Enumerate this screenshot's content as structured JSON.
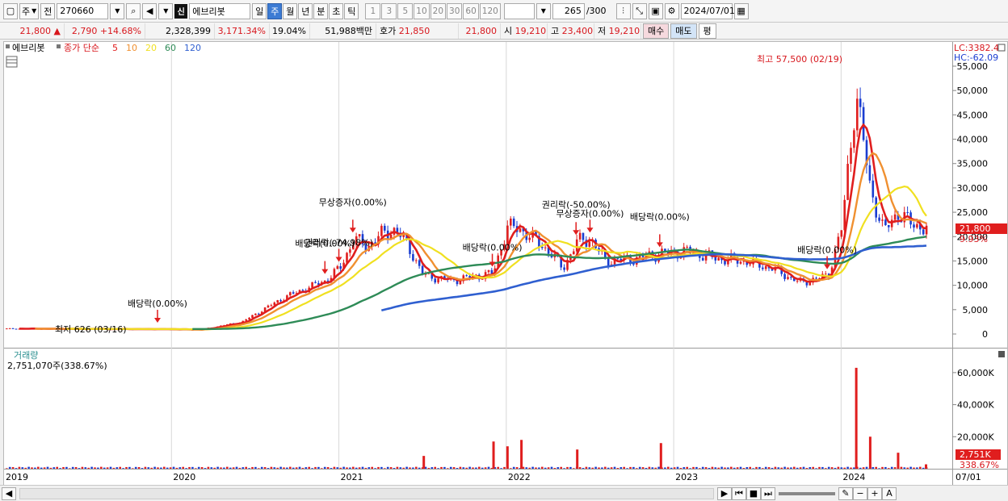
{
  "toolbar": {
    "period_type": "주",
    "prev_label": "전",
    "code": "270660",
    "market_badge": "신",
    "stock_name": "에브리봇",
    "periods": [
      "일",
      "주",
      "월",
      "년",
      "분",
      "초",
      "틱"
    ],
    "active_period": "주",
    "intervals": [
      "1",
      "3",
      "5",
      "10",
      "20",
      "30",
      "60",
      "120"
    ],
    "count": "265",
    "count_max": "/300",
    "date": "2024/07/01"
  },
  "quote": {
    "price": "21,800",
    "change_arrow": "▲",
    "change": "2,790",
    "change_pct": "+14.68%",
    "volume": "2,328,399",
    "volume_pct": "3,171.34%",
    "turnover": "19.04%",
    "amount": "51,988백만",
    "hoga_label": "호가",
    "ask": "21,850",
    "bid": "21,800",
    "open_label": "시",
    "open": "19,210",
    "high_label": "고",
    "high": "23,400",
    "low_label": "저",
    "low": "19,210",
    "buy_label": "매수",
    "sell_label": "매도",
    "avg_label": "평"
  },
  "price_panel": {
    "stock_tab": "에브리봇",
    "legend_close": "종가 단순",
    "ma_legend": [
      {
        "label": "5",
        "color": "#e01e1e"
      },
      {
        "label": "10",
        "color": "#f09030"
      },
      {
        "label": "20",
        "color": "#f0e020"
      },
      {
        "label": "60",
        "color": "#2e8b57"
      },
      {
        "label": "120",
        "color": "#2f5fd0"
      }
    ],
    "lc_label": "LC:3382.43",
    "hc_label": "HC:-62.09",
    "current_price_tag": "21,800",
    "current_pct_tag": "9.93%",
    "high_note": "최고 57,500 (02/19)",
    "low_note": "최저 626 (03/16)"
  },
  "volume_panel": {
    "title": "거래량",
    "summary": "2,751,070주(338.67%)",
    "current_tag": "2,751K",
    "current_pct": "338.67%"
  },
  "chart_data": {
    "type": "candlestick-with-volume",
    "price_axis": {
      "min": 0,
      "max": 55000,
      "ticks": [
        "0",
        "5,000",
        "10,000",
        "15,000",
        "20,000",
        "25,000",
        "30,000",
        "35,000",
        "40,000",
        "45,000",
        "50,000",
        "55,000"
      ]
    },
    "volume_axis": {
      "ticks": [
        "20,000K",
        "40,000K",
        "60,000K"
      ]
    },
    "x_axis_labels": [
      "2019",
      "2020",
      "2021",
      "2022",
      "2023",
      "2024",
      "07/01"
    ],
    "annotations": [
      {
        "text": "배당락(0.00%)",
        "date": "2019-12"
      },
      {
        "text": "배당락(0.00%)",
        "date": "2020-12"
      },
      {
        "text": "권리락(-74.98%)",
        "date": "2021-01"
      },
      {
        "text": "무상증자(0.00%)",
        "date": "2021-02"
      },
      {
        "text": "배당락(0.00%)",
        "date": "2021-12"
      },
      {
        "text": "권리락(-50.00%)",
        "date": "2022-06"
      },
      {
        "text": "무상증자(0.00%)",
        "date": "2022-07"
      },
      {
        "text": "배당락(0.00%)",
        "date": "2022-12"
      },
      {
        "text": "배당락(0.00%)",
        "date": "2023-12"
      }
    ],
    "close_series": {
      "name": "종가",
      "dates": [
        "2019-01",
        "2019-06",
        "2019-12",
        "2020-03",
        "2020-06",
        "2020-09",
        "2020-12",
        "2021-01",
        "2021-02",
        "2021-03",
        "2021-04",
        "2021-05",
        "2021-06",
        "2021-07",
        "2021-09",
        "2021-12",
        "2022-01",
        "2022-02",
        "2022-04",
        "2022-05",
        "2022-06",
        "2022-07",
        "2022-08",
        "2022-10",
        "2022-12",
        "2023-02",
        "2023-04",
        "2023-06",
        "2023-08",
        "2023-10",
        "2023-12",
        "2024-01",
        "2024-02",
        "2024-03",
        "2024-04",
        "2024-05",
        "2024-06",
        "2024-07"
      ],
      "values": [
        1100,
        1050,
        1000,
        900,
        2500,
        7500,
        11000,
        13500,
        19500,
        18000,
        20500,
        21500,
        17500,
        12000,
        11000,
        12500,
        22000,
        21500,
        17000,
        13500,
        19000,
        19500,
        15000,
        15500,
        16500,
        17000,
        15500,
        15000,
        13500,
        10500,
        12000,
        22000,
        50000,
        30000,
        21000,
        25000,
        22500,
        21800
      ]
    },
    "ma_series": [
      {
        "name": "5",
        "color": "#e01e1e"
      },
      {
        "name": "10",
        "color": "#f09030"
      },
      {
        "name": "20",
        "color": "#f0e020"
      },
      {
        "name": "60",
        "color": "#2e8b57"
      },
      {
        "name": "120",
        "color": "#2f5fd0"
      }
    ],
    "volume_spikes_k": [
      {
        "date": "2021-07",
        "value": 8000
      },
      {
        "date": "2021-12",
        "value": 17000
      },
      {
        "date": "2022-01",
        "value": 14000
      },
      {
        "date": "2022-02",
        "value": 18000
      },
      {
        "date": "2022-06",
        "value": 12000
      },
      {
        "date": "2022-12",
        "value": 16000
      },
      {
        "date": "2024-02",
        "value": 63000
      },
      {
        "date": "2024-03",
        "value": 20000
      },
      {
        "date": "2024-05",
        "value": 10000
      },
      {
        "date": "2024-07",
        "value": 2751
      }
    ]
  }
}
